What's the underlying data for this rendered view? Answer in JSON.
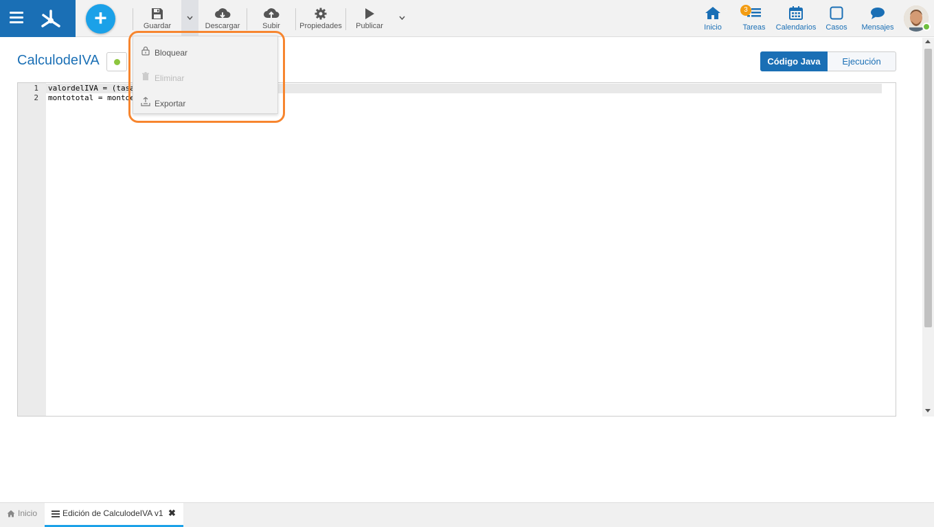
{
  "toolbar": {
    "save_label": "Guardar",
    "download_label": "Descargar",
    "upload_label": "Subir",
    "properties_label": "Propiedades",
    "publish_label": "Publicar"
  },
  "nav": {
    "home_label": "Inicio",
    "tasks_label": "Tareas",
    "tasks_badge": "3",
    "calendars_label": "Calendarios",
    "cases_label": "Casos",
    "messages_label": "Mensajes"
  },
  "page": {
    "title": "CalculodeIVA"
  },
  "view_toggle": {
    "java_label": "Código Java",
    "execution_label": "Ejecución"
  },
  "editor": {
    "lines": [
      {
        "number": "1",
        "code": "valordelIVA = (tasa"
      },
      {
        "number": "2",
        "code": "montototal = montoe"
      }
    ]
  },
  "dropdown": {
    "lock_label": "Bloquear",
    "delete_label": "Eliminar",
    "export_label": "Exportar"
  },
  "bottom_tabs": {
    "home_label": "Inicio",
    "edit_label": "Edición de CalculodeIVA v1"
  },
  "colors": {
    "brand": "#1a6fb5",
    "accent": "#1ba1e8",
    "highlight": "#f7852e",
    "status_ok": "#8dc63f",
    "badge": "#f39c12"
  }
}
